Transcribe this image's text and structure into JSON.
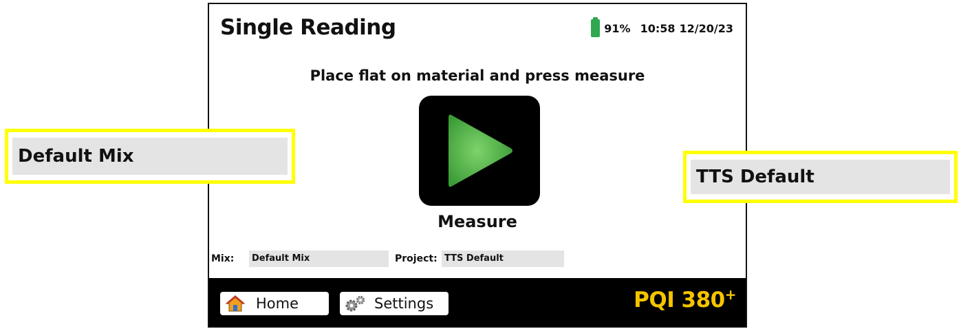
{
  "header": {
    "title": "Single Reading",
    "battery_percent": "91%",
    "time": "10:58",
    "date": "12/20/23",
    "battery_level": 0.91
  },
  "main": {
    "instruction": "Place flat on material and press measure",
    "measure_label": "Measure",
    "mix_label": "Mix:",
    "mix_value": "Default Mix",
    "project_label": "Project:",
    "project_value": "TTS Default"
  },
  "footer": {
    "home_label": "Home",
    "settings_label": "Settings",
    "brand": "PQI 380",
    "brand_superscript": "+"
  },
  "callouts": {
    "mix": "Default Mix",
    "project": "TTS Default"
  },
  "colors": {
    "accent_yellow": "#f5c400",
    "callout_border": "#ffff00",
    "battery_green": "#2fa84f",
    "play_green": "#4cb648",
    "field_gray": "#e4e4e4"
  },
  "icons": {
    "battery": "battery-icon",
    "play": "play-icon",
    "home": "home-icon",
    "settings": "gears-icon"
  }
}
